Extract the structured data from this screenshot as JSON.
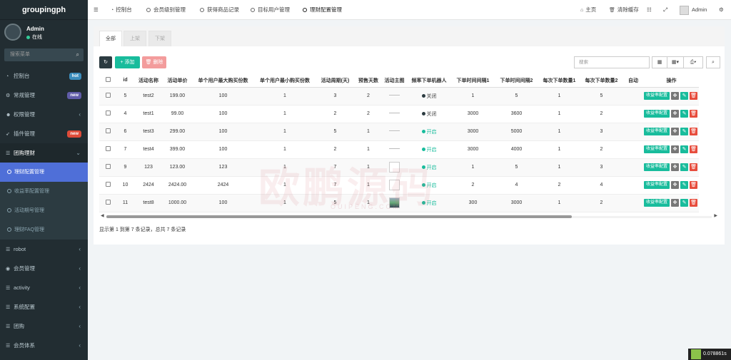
{
  "app": {
    "title": "groupingph"
  },
  "user": {
    "name": "Admin",
    "status": "在线"
  },
  "sidebar": {
    "search_placeholder": "搜索菜单",
    "items": [
      {
        "label": "控制台",
        "icon": "dashboard-icon",
        "badge": "hot",
        "badge_color": "#3c8dbc"
      },
      {
        "label": "常规管理",
        "icon": "cogs-icon",
        "badge": "new",
        "badge_color": "#605ca8"
      },
      {
        "label": "权限管理",
        "icon": "group-icon",
        "chevron": "‹"
      },
      {
        "label": "插件管理",
        "icon": "rocket-icon",
        "badge": "new",
        "badge_color": "#dd4b39"
      },
      {
        "label": "团购理财",
        "icon": "list-icon",
        "chevron": "⌄",
        "open": true
      },
      {
        "label": "robot",
        "icon": "list-icon",
        "chevron": "‹"
      },
      {
        "label": "会员管理",
        "icon": "user-circle-icon",
        "chevron": "‹"
      },
      {
        "label": "activity",
        "icon": "list-icon",
        "chevron": "‹"
      },
      {
        "label": "系统配置",
        "icon": "list-icon",
        "chevron": "‹"
      },
      {
        "label": "团购",
        "icon": "list-icon",
        "chevron": "‹"
      },
      {
        "label": "会员体系",
        "icon": "list-icon",
        "chevron": "‹"
      }
    ],
    "sub_items": [
      {
        "label": "理财配置管理",
        "active": true
      },
      {
        "label": "收益率配置管理"
      },
      {
        "label": "活动期号管理"
      },
      {
        "label": "理财FAQ管理"
      }
    ]
  },
  "topbar": {
    "tabs": [
      {
        "label": "控制台",
        "icon": "dashboard-icon"
      },
      {
        "label": "会员级别管理"
      },
      {
        "label": "获得商品记录"
      },
      {
        "label": "目标用户管理"
      },
      {
        "label": "理财配置管理",
        "active": true
      }
    ],
    "home_label": "主页",
    "clear_cache_label": "清除缓存",
    "user_label": "Admin"
  },
  "panel": {
    "tabs": [
      "全部",
      "上架",
      "下架"
    ],
    "add_label": "添加",
    "delete_label": "删除",
    "search_placeholder": "搜索",
    "columns": [
      "id",
      "活动名称",
      "活动单价",
      "单个用户最大购买份数",
      "单个用户最小购买份数",
      "活动周期(天)",
      "预售天数",
      "活动主图",
      "频率下单机器人",
      "下单时间间隔1",
      "下单时间间隔2",
      "每次下单数量1",
      "每次下单数量2",
      "自动",
      "操作"
    ],
    "rows": [
      {
        "id": "5",
        "name": "test2",
        "price": "199.00",
        "max": "100",
        "min": "1",
        "cycle": "3",
        "presale": "2",
        "img": "blank",
        "robot": "关闭",
        "robot_on": false,
        "i1": "1",
        "i2": "5",
        "q1": "1",
        "q2": "5"
      },
      {
        "id": "4",
        "name": "test1",
        "price": "99.00",
        "max": "100",
        "min": "1",
        "cycle": "2",
        "presale": "2",
        "img": "blank",
        "robot": "关闭",
        "robot_on": false,
        "i1": "3000",
        "i2": "3600",
        "q1": "1",
        "q2": "2"
      },
      {
        "id": "6",
        "name": "test3",
        "price": "299.00",
        "max": "100",
        "min": "1",
        "cycle": "5",
        "presale": "1",
        "img": "blank",
        "robot": "开启",
        "robot_on": true,
        "i1": "3000",
        "i2": "5000",
        "q1": "1",
        "q2": "3"
      },
      {
        "id": "7",
        "name": "test4",
        "price": "399.00",
        "max": "100",
        "min": "1",
        "cycle": "2",
        "presale": "1",
        "img": "blank",
        "robot": "开启",
        "robot_on": true,
        "i1": "3000",
        "i2": "4000",
        "q1": "1",
        "q2": "2"
      },
      {
        "id": "9",
        "name": "123",
        "price": "123.00",
        "max": "123",
        "min": "1",
        "cycle": "7",
        "presale": "1",
        "img": "box",
        "robot": "开启",
        "robot_on": true,
        "i1": "1",
        "i2": "5",
        "q1": "1",
        "q2": "3"
      },
      {
        "id": "10",
        "name": "2424",
        "price": "2424.00",
        "max": "2424",
        "min": "1",
        "cycle": "7",
        "presale": "1",
        "img": "box",
        "robot": "开启",
        "robot_on": true,
        "i1": "2",
        "i2": "4",
        "q1": "2",
        "q2": "4"
      },
      {
        "id": "11",
        "name": "test8",
        "price": "1000.00",
        "max": "100",
        "min": "1",
        "cycle": "5",
        "presale": "1",
        "img": "photo",
        "robot": "开启",
        "robot_on": true,
        "i1": "300",
        "i2": "3000",
        "q1": "1",
        "q2": "2"
      }
    ],
    "op_label": "收益率配置",
    "pager": "显示第 1 到第 7 条记录，总共 7 条记录"
  },
  "watermark": {
    "text": "欧鹏源码",
    "sub": "OUIPENG.COM"
  },
  "timer": "0.078861s",
  "colors": {
    "primary": "#18bc9c",
    "danger": "#e74c3c",
    "sidebar": "#222d32",
    "active": "#4f6fd8"
  }
}
